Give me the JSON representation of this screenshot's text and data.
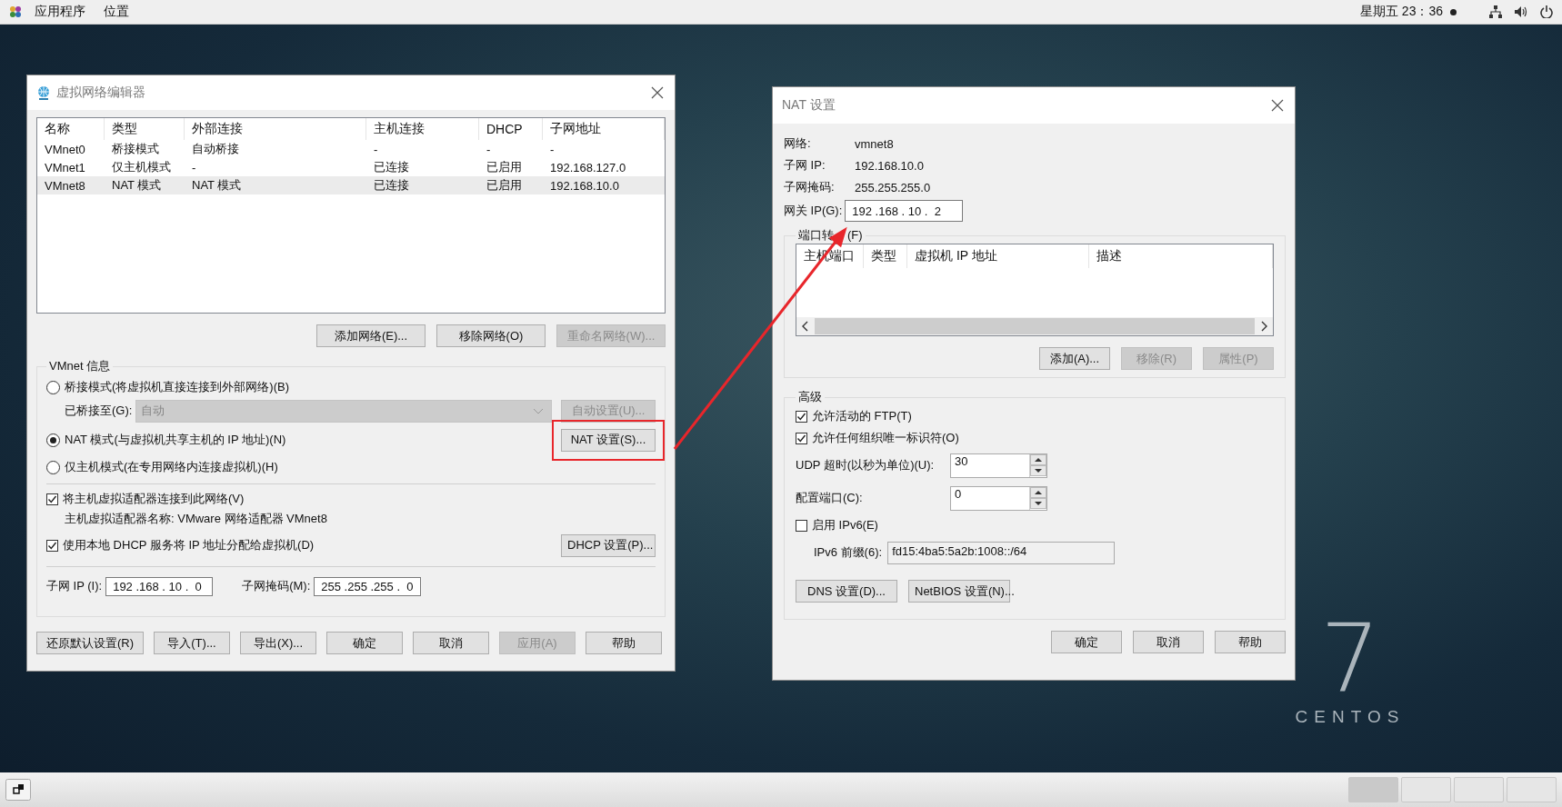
{
  "top_bar": {
    "menus": [
      "应用程序",
      "位置"
    ],
    "clock": "星期五 23：36"
  },
  "network_editor": {
    "title": "虚拟网络编辑器",
    "table": {
      "columns": [
        "名称",
        "类型",
        "外部连接",
        "主机连接",
        "DHCP",
        "子网地址"
      ],
      "rows": [
        {
          "cells": [
            "VMnet0",
            "桥接模式",
            "自动桥接",
            "-",
            "-",
            "-"
          ],
          "selected": false
        },
        {
          "cells": [
            "VMnet1",
            "仅主机模式",
            "-",
            "已连接",
            "已启用",
            "192.168.127.0"
          ],
          "selected": false
        },
        {
          "cells": [
            "VMnet8",
            "NAT 模式",
            "NAT 模式",
            "已连接",
            "已启用",
            "192.168.10.0"
          ],
          "selected": true
        }
      ]
    },
    "list_buttons": [
      {
        "label": "添加网络(E)...",
        "disabled": false
      },
      {
        "label": "移除网络(O)",
        "disabled": false
      },
      {
        "label": "重命名网络(W)...",
        "disabled": true
      }
    ],
    "vmnet_info": {
      "title": "VMnet 信息",
      "modes": [
        {
          "label": "桥接模式(将虚拟机直接连接到外部网络)(B)",
          "selected": false
        },
        {
          "label": "NAT 模式(与虚拟机共享主机的 IP 地址)(N)",
          "selected": true
        },
        {
          "label": "仅主机模式(在专用网络内连接虚拟机)(H)",
          "selected": false
        }
      ],
      "bridged_to": {
        "label": "已桥接至(G):",
        "value": "自动",
        "disabled": true
      },
      "auto_settings_button": {
        "label": "自动设置(U)...",
        "disabled": true
      },
      "nat_settings_button": {
        "label": "NAT 设置(S)...",
        "disabled": false,
        "highlighted": true
      },
      "connect_adapter": {
        "label": "将主机虚拟适配器连接到此网络(V)",
        "checked": true
      },
      "adapter_name": "主机虚拟适配器名称: VMware 网络适配器 VMnet8",
      "use_dhcp": {
        "label": "使用本地 DHCP 服务将 IP 地址分配给虚拟机(D)",
        "checked": true
      },
      "dhcp_settings_button": {
        "label": "DHCP 设置(P)...",
        "disabled": false
      },
      "subnet_ip": {
        "label": "子网 IP (I):",
        "value": "192 .168 . 10 .  0"
      },
      "subnet_mask": {
        "label": "子网掩码(M):",
        "value": "255 .255 .255 .  0"
      }
    },
    "buttons": [
      {
        "label": "还原默认设置(R)",
        "disabled": false
      },
      {
        "label": "导入(T)...",
        "disabled": false
      },
      {
        "label": "导出(X)...",
        "disabled": false
      },
      {
        "label": "确定",
        "disabled": false
      },
      {
        "label": "取消",
        "disabled": false
      },
      {
        "label": "应用(A)",
        "disabled": true
      },
      {
        "label": "帮助",
        "disabled": false
      }
    ]
  },
  "nat_settings": {
    "title": "NAT 设置",
    "info": [
      {
        "label": "网络:",
        "value": "vmnet8"
      },
      {
        "label": "子网 IP:",
        "value": "192.168.10.0"
      },
      {
        "label": "子网掩码:",
        "value": "255.255.255.0"
      }
    ],
    "gateway": {
      "label": "网关 IP(G):",
      "value": "192 .168 . 10 .  2"
    },
    "port_forwarding": {
      "title": "端口转",
      "title_end": "(F)",
      "columns": [
        "主机端口",
        "类型",
        "虚拟机 IP 地址",
        "描述"
      ],
      "buttons": [
        {
          "label": "添加(A)...",
          "disabled": false
        },
        {
          "label": "移除(R)",
          "disabled": true
        },
        {
          "label": "属性(P)",
          "disabled": true
        }
      ]
    },
    "advanced": {
      "title": "高级",
      "options": [
        {
          "kind": "checkbox",
          "label": "允许活动的 FTP(T)",
          "checked": true
        },
        {
          "kind": "checkbox",
          "label": "允许任何组织唯一标识符(O)",
          "checked": true
        },
        {
          "kind": "spinner",
          "label": "UDP 超时(以秒为单位)(U):",
          "value": "30"
        },
        {
          "kind": "spinner",
          "label": "配置端口(C):",
          "value": "0"
        },
        {
          "kind": "checkbox",
          "label": "启用 IPv6(E)",
          "checked": false
        },
        {
          "kind": "field",
          "label": "IPv6 前缀(6):",
          "value": "fd15:4ba5:5a2b:1008::/64",
          "disabled": true
        }
      ],
      "buttons": [
        {
          "label": "DNS 设置(D)...",
          "disabled": false
        },
        {
          "label": "NetBIOS 设置(N)...",
          "disabled": false
        }
      ]
    },
    "buttons": [
      {
        "label": "确定",
        "disabled": false
      },
      {
        "label": "取消",
        "disabled": false
      },
      {
        "label": "帮助",
        "disabled": false
      }
    ]
  },
  "desktop_logo": {
    "numeral": "7",
    "name": "CENTOS"
  },
  "callout_arrow": true,
  "taskbar": {
    "workspaces": [
      {
        "selected": true
      },
      {
        "selected": false
      },
      {
        "selected": false
      },
      {
        "selected": false
      }
    ]
  }
}
